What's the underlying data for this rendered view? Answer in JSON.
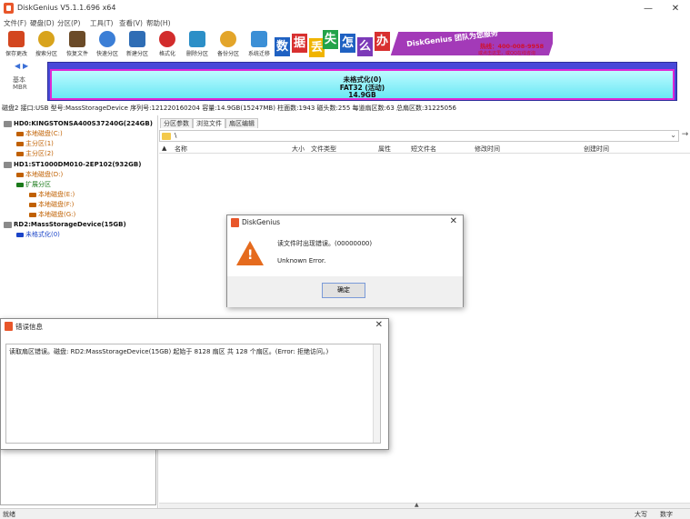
{
  "window": {
    "title": "DiskGenius V5.1.1.696 x64",
    "controls": [
      "—",
      "☐",
      "✕"
    ]
  },
  "menu": [
    "文件(F)",
    "硬盘(D)",
    "分区(P)",
    "工具(T)",
    "查看(V)",
    "帮助(H)"
  ],
  "toolbar": [
    {
      "label": "保存更改",
      "color": "#d3461f"
    },
    {
      "label": "搜索分区",
      "color": "#d8a31c"
    },
    {
      "label": "恢复文件",
      "color": "#6b4b28"
    },
    {
      "label": "快速分区",
      "color": "#3b7ed6"
    },
    {
      "label": "新建分区",
      "color": "#2f6db5"
    },
    {
      "label": "格式化",
      "color": "#d22c2c"
    },
    {
      "label": "删除分区",
      "color": "#2c8fc7"
    },
    {
      "label": "备份分区",
      "color": "#e3a52a"
    },
    {
      "label": "系统迁移",
      "color": "#3b8fd6"
    }
  ],
  "banner": {
    "tiles": [
      {
        "char": "数",
        "color": "#1f61c2"
      },
      {
        "char": "据",
        "color": "#d83030"
      },
      {
        "char": "丢",
        "color": "#f0b400"
      },
      {
        "char": "失",
        "color": "#23a34a"
      },
      {
        "char": "怎",
        "color": "#1f61c2"
      },
      {
        "char": "么",
        "color": "#7c3ab8"
      },
      {
        "char": "办",
        "color": "#d83030"
      }
    ],
    "slogan": "DiskGenius 团队为您服务",
    "phone": "热线：400-008-9958",
    "qq": "或点击这里，或QQ在线咨询"
  },
  "disk_nav": {
    "label": "基本\nMBR"
  },
  "disk_map": {
    "name": "未格式化(0)",
    "fs": "FAT32 (活动)",
    "size": "14.9GB"
  },
  "disk_info": "磁盘2 接口:USB 型号:MassStorageDevice 序列号:121220160204 容量:14.9GB(15247MB) 柱面数:1943 磁头数:255 每道扇区数:63 总扇区数:31225056",
  "tree": [
    {
      "label": "HD0:KINGSTONSA400S37240G(224GB)",
      "kind": "disk",
      "color": "#8a8a8a"
    },
    {
      "label": "本地磁盘(C:)",
      "kind": "part",
      "color": "#c06000"
    },
    {
      "label": "主分区(1)",
      "kind": "part",
      "color": "#c06000"
    },
    {
      "label": "主分区(2)",
      "kind": "part",
      "color": "#c06000"
    },
    {
      "label": "HD1:ST1000DM010-2EP102(932GB)",
      "kind": "disk",
      "color": "#8a8a8a"
    },
    {
      "label": "本地磁盘(D:)",
      "kind": "part",
      "color": "#c06000"
    },
    {
      "label": "扩展分区",
      "kind": "ext",
      "color": "#1a7a1a"
    },
    {
      "label": "本地磁盘(E:)",
      "kind": "part",
      "color": "#c06000"
    },
    {
      "label": "本地磁盘(F:)",
      "kind": "part",
      "color": "#c06000"
    },
    {
      "label": "本地磁盘(G:)",
      "kind": "part",
      "color": "#c06000"
    },
    {
      "label": "RD2:MassStorageDevice(15GB)",
      "kind": "disk",
      "color": "#8a8a8a"
    },
    {
      "label": "未格式化(0)",
      "kind": "sel",
      "color": "#1a44c8"
    }
  ],
  "tabs": [
    "分区参数",
    "浏览文件",
    "扇区编辑"
  ],
  "path": "\\",
  "file_columns": [
    "名称",
    "大小",
    "文件类型",
    "属性",
    "短文件名",
    "修改时间",
    "创建时间"
  ],
  "error_dialog": {
    "title": "DiskGenius",
    "message": "读文件时出现错误。(00000000)",
    "detail": "Unknown Error.",
    "ok_label": "确定"
  },
  "log_dialog": {
    "title": "错误信息",
    "text": "读取扇区错误。磁盘: RD2:MassStorageDevice(15GB) 起始于 8128 扇区 共 128 个扇区。(Error: 拒绝访问。)"
  },
  "status": {
    "ready": "就绪",
    "caps": "大写",
    "num": "数字"
  }
}
